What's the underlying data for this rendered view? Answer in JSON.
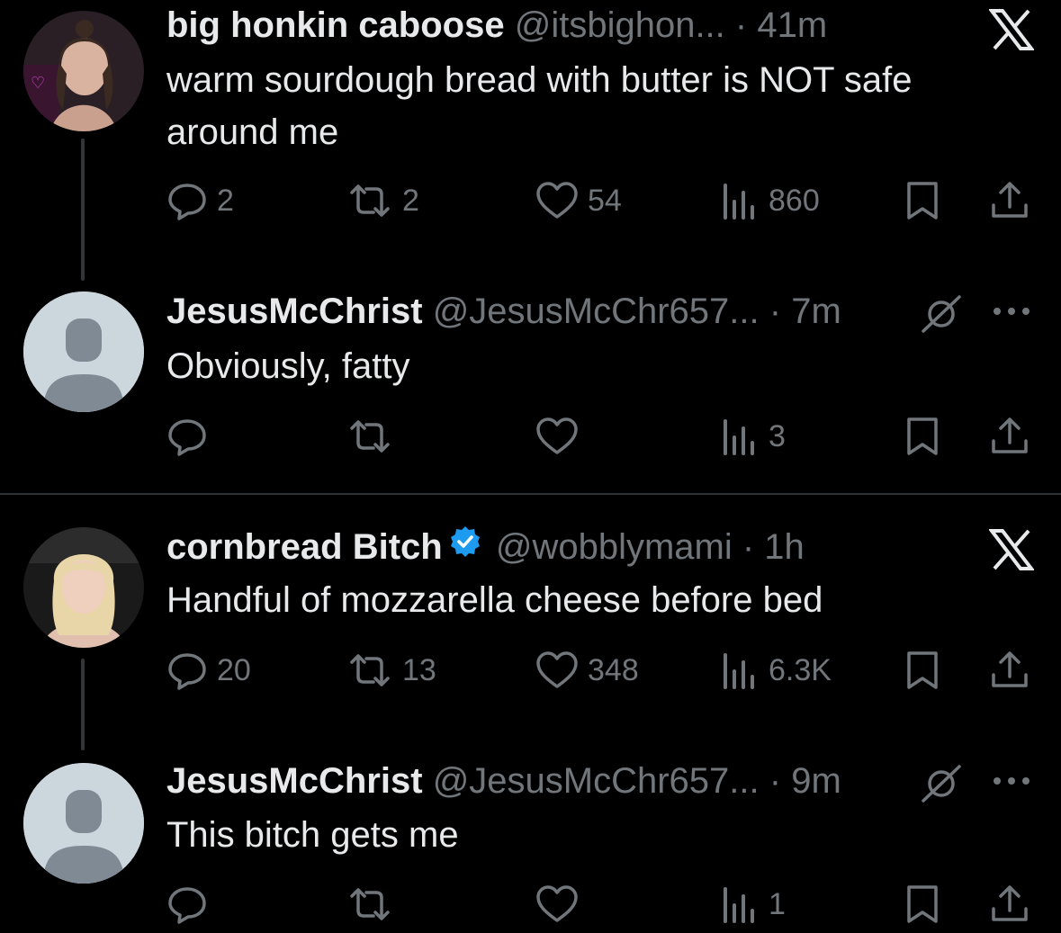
{
  "colors": {
    "background": "#000000",
    "text": "#e7e9ea",
    "muted": "#71767b",
    "verified": "#1d9bf0",
    "divider": "#2f3336"
  },
  "tweets": [
    {
      "name": "big honkin caboose",
      "handle": "@itsbighon...",
      "time": "· 41m",
      "text": "warm sourdough bread with butter is NOT safe around me",
      "replies": "2",
      "reposts": "2",
      "likes": "54",
      "views": "860",
      "corner_icon": "x-logo-icon"
    },
    {
      "name": "JesusMcChrist",
      "handle": "@JesusMcChr657...",
      "time": "· 7m",
      "text": "Obviously, fatty",
      "replies": "",
      "reposts": "",
      "likes": "",
      "views": "3",
      "corner_icon": "grok-icon"
    },
    {
      "name": "cornbread Bitch",
      "handle": "@wobblymami",
      "time": "· 1h",
      "text": "Handful of mozzarella cheese before bed",
      "replies": "20",
      "reposts": "13",
      "likes": "348",
      "views": "6.3K",
      "corner_icon": "x-logo-icon"
    },
    {
      "name": "JesusMcChrist",
      "handle": "@JesusMcChr657...",
      "time": "· 9m",
      "text": "This bitch gets me",
      "replies": "",
      "reposts": "",
      "likes": "",
      "views": "1",
      "corner_icon": "grok-icon"
    }
  ]
}
